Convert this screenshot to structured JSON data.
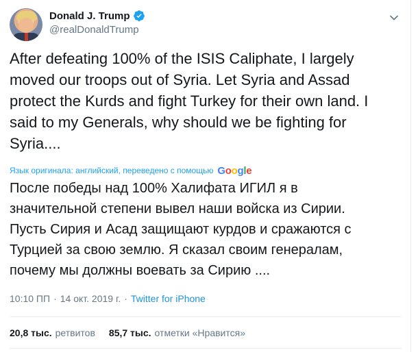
{
  "author": {
    "display_name": "Donald J. Trump",
    "handle": "@realDonaldTrump",
    "verified_icon": "verified-badge-icon"
  },
  "tweet": {
    "text": "After defeating 100% of the ISIS Caliphate, I largely\nmoved our troops out of Syria. Let Syria and Assad\nprotect the Kurds and fight Turkey for their own land. I\nsaid to my Generals, why should we be fighting for\nSyria....",
    "translation_note": "Язык оригинала: английский, переведено с помощью",
    "translation_provider": "Google",
    "translated_text": "После победы над 100% Халифата ИГИЛ я в\nзначительной степени вывел наши войска из Сирии.\nПусть Сирия и Асад защищают курдов и сражаются с\nТурцией за свою землю. Я сказал своим генералам,\nпочему мы должны воевать за Сирию ....",
    "time": "10:10 ПП",
    "separator": "·",
    "date": "14 окт. 2019 г.",
    "source": "Twitter for iPhone"
  },
  "stats": {
    "retweets_count": "20,8 тыс.",
    "retweets_label": "ретвитов",
    "likes_count": "85,7 тыс.",
    "likes_label": "отметки «Нравится»"
  },
  "colors": {
    "accent": "#1da1f2",
    "secondary_text": "#657786",
    "primary_text": "#14171a",
    "divider": "#e6ecf0"
  }
}
